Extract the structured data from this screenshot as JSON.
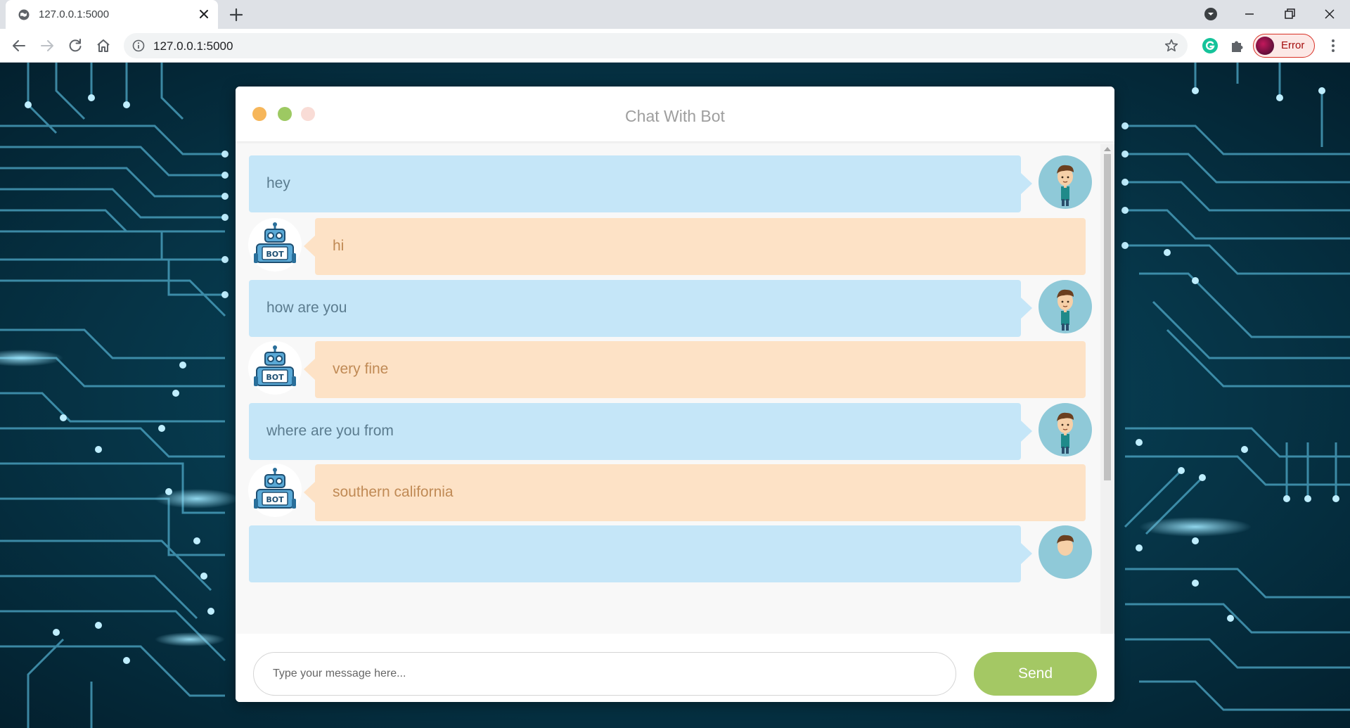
{
  "browser": {
    "tab_title": "127.0.0.1:5000",
    "url": "127.0.0.1:5000",
    "profile_label": "Error",
    "icons": [
      "globe-icon",
      "close-icon",
      "plus-icon",
      "back-icon",
      "forward-icon",
      "reload-icon",
      "home-icon",
      "info-icon",
      "star-icon",
      "grammarly-icon",
      "puzzle-icon",
      "more-vert-icon"
    ]
  },
  "chat": {
    "title": "Chat With Bot",
    "window_dots": [
      "#f6b65a",
      "#9dc962",
      "#f9dcd6"
    ],
    "messages": [
      {
        "sender": "user",
        "text": "hey"
      },
      {
        "sender": "bot",
        "text": "hi"
      },
      {
        "sender": "user",
        "text": "how are you"
      },
      {
        "sender": "bot",
        "text": "very fine"
      },
      {
        "sender": "user",
        "text": "where are you from"
      },
      {
        "sender": "bot",
        "text": "southern california"
      }
    ],
    "input_placeholder": "Type your message here...",
    "send_label": "Send"
  },
  "colors": {
    "user_bubble": "#c5e6f8",
    "bot_bubble": "#fde2c6",
    "send_button": "#a4c864"
  }
}
